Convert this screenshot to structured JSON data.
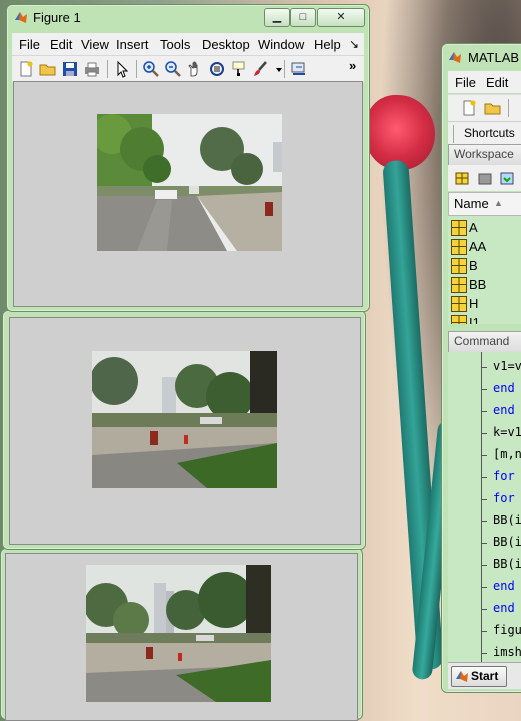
{
  "figure1": {
    "title": "Figure 1",
    "menu": [
      "File",
      "Edit",
      "View",
      "Insert",
      "Tools",
      "Desktop",
      "Window",
      "Help"
    ],
    "menu_arrow": "↘",
    "overflow": "»"
  },
  "matlab": {
    "title": "MATLAB",
    "menu": [
      "File",
      "Edit"
    ],
    "shortcuts": "Shortcuts",
    "workspace": "Workspace",
    "name_col": "Name",
    "sort_arrow": "▲",
    "variables": [
      "A",
      "AA",
      "B",
      "BB",
      "H",
      "I1"
    ],
    "command_header": "Command",
    "command_lines": [
      {
        "text": "v1=v",
        "kw": false
      },
      {
        "text": "end",
        "kw": true
      },
      {
        "text": "end",
        "kw": true
      },
      {
        "text": "k=v1,",
        "kw": false
      },
      {
        "text": "[m,n",
        "kw": false
      },
      {
        "text": "for",
        "kw": true
      },
      {
        "text": "for",
        "kw": true
      },
      {
        "text": "BB(i,",
        "kw": false
      },
      {
        "text": "BB(i,",
        "kw": false
      },
      {
        "text": "BB(i,",
        "kw": false
      },
      {
        "text": "end",
        "kw": true
      },
      {
        "text": "end",
        "kw": true
      },
      {
        "text": "figu",
        "kw": false
      },
      {
        "text": "imsh",
        "kw": false
      }
    ],
    "start_label": "Start"
  },
  "colors": {
    "frame": "#bfe3b5",
    "client": "#cfcfcf",
    "keyword": "#0000ff",
    "accent": "#d32d45"
  },
  "icons": [
    "matlab-logo-icon",
    "minimize-icon",
    "maximize-icon",
    "close-icon",
    "new-figure-icon",
    "open-file-icon",
    "save-icon",
    "print-icon",
    "pointer-icon",
    "zoom-in-icon",
    "zoom-out-icon",
    "pan-icon",
    "rotate-icon",
    "data-cursor-icon",
    "brush-icon",
    "link-icon"
  ]
}
